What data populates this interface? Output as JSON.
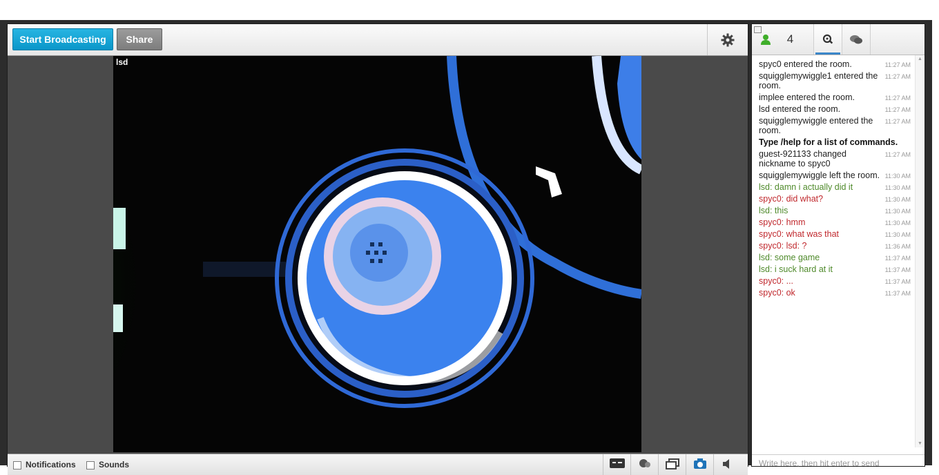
{
  "toolbar": {
    "start_broadcasting": "Start Broadcasting",
    "share": "Share",
    "settings_icon": "gear-icon"
  },
  "video": {
    "label": "lsd"
  },
  "bottom_bar": {
    "notifications": "Notifications",
    "sounds": "Sounds"
  },
  "chat": {
    "user_count": "4",
    "input_placeholder": "Write here, then hit enter to send",
    "messages": [
      {
        "text": "spyc0 entered the room.",
        "time": "11:27 AM",
        "type": "sys"
      },
      {
        "text": "squigglemywiggle1 entered the room.",
        "time": "11:27 AM",
        "type": "sys"
      },
      {
        "text": "implee entered the room.",
        "time": "11:27 AM",
        "type": "sys"
      },
      {
        "text": "lsd entered the room.",
        "time": "11:27 AM",
        "type": "sys"
      },
      {
        "text": "squigglemywiggle entered the room.",
        "time": "11:27 AM",
        "type": "sys"
      },
      {
        "text": "Type /help for a list of commands.",
        "time": "",
        "type": "help"
      },
      {
        "text": "guest-921133 changed nickname to spyc0",
        "time": "11:27 AM",
        "type": "sys"
      },
      {
        "text": "squigglemywiggle left the room.",
        "time": "11:30 AM",
        "type": "sys"
      },
      {
        "text": "lsd: damn i actually did it",
        "time": "11:30 AM",
        "type": "lsd"
      },
      {
        "text": "spyc0: did what?",
        "time": "11:30 AM",
        "type": "spyc"
      },
      {
        "text": "lsd: this",
        "time": "11:30 AM",
        "type": "lsd"
      },
      {
        "text": "spyc0: hmm",
        "time": "11:30 AM",
        "type": "spyc"
      },
      {
        "text": "spyc0: what was that",
        "time": "11:30 AM",
        "type": "spyc"
      },
      {
        "text": "spyc0: lsd: ?",
        "time": "11:36 AM",
        "type": "spyc"
      },
      {
        "text": "lsd: some game",
        "time": "11:37 AM",
        "type": "lsd"
      },
      {
        "text": "lsd: i suck hard at it",
        "time": "11:37 AM",
        "type": "lsd"
      },
      {
        "text": "spyc0: ...",
        "time": "11:37 AM",
        "type": "spyc"
      },
      {
        "text": "spyc0: ok",
        "time": "11:37 AM",
        "type": "spyc"
      }
    ]
  },
  "colors": {
    "start_button": "#0a96c9",
    "lsd_message": "#4f8a2b",
    "spyc_message": "#c0282d"
  }
}
